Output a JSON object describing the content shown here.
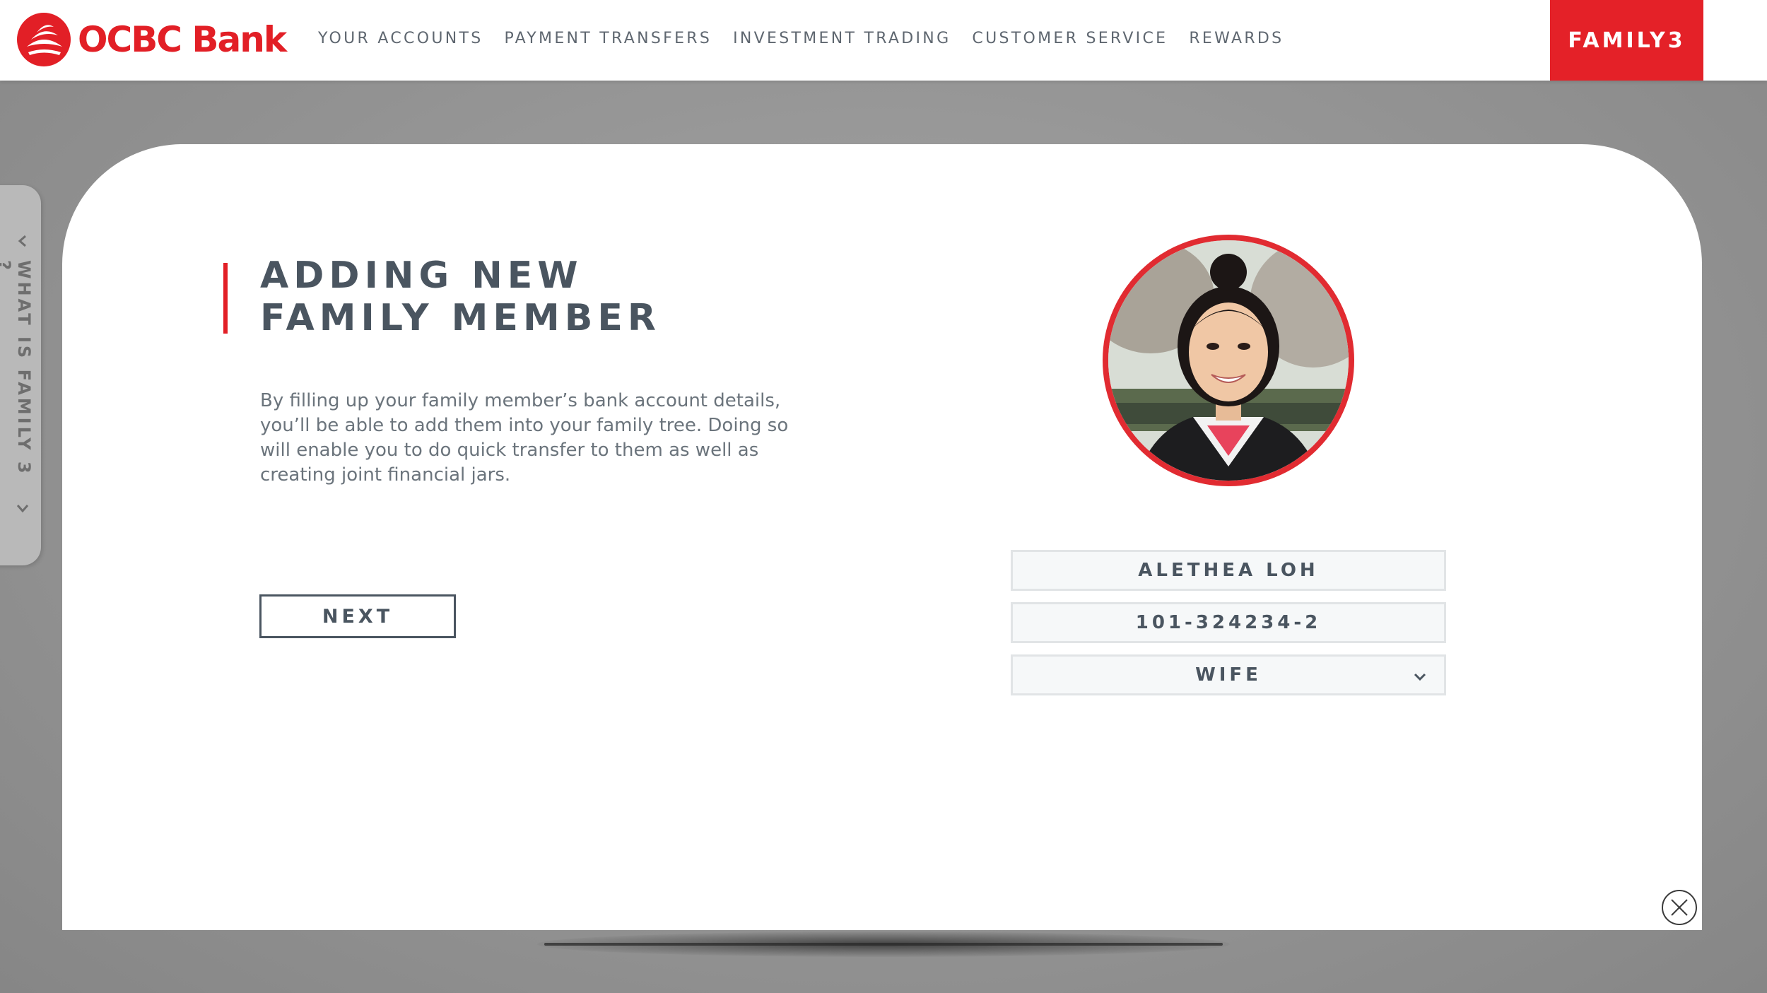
{
  "brand": {
    "name": "OCBC Bank",
    "accent": "#e21f26"
  },
  "nav": {
    "items": [
      "YOUR ACCOUNTS",
      "PAYMENT TRANSFERS",
      "INVESTMENT TRADING",
      "CUSTOMER SERVICE",
      "REWARDS"
    ],
    "cta_label": "FAMILY3"
  },
  "side_tab": {
    "label": "WHAT IS FAMILY 3 ?"
  },
  "form": {
    "title_line1": "ADDING NEW",
    "title_line2": "FAMILY MEMBER",
    "description": "By filling up your family member’s bank account details, you’ll be able to add them into your family tree. Doing so will enable you to do quick transfer to them as well as creating joint financial jars.",
    "next_label": "NEXT",
    "member_name": "ALETHEA LOH",
    "account_number": "101-324234-2",
    "relationship": "WIFE"
  },
  "icons": {
    "close": "close-icon",
    "chevron": "chevron-down-icon"
  }
}
